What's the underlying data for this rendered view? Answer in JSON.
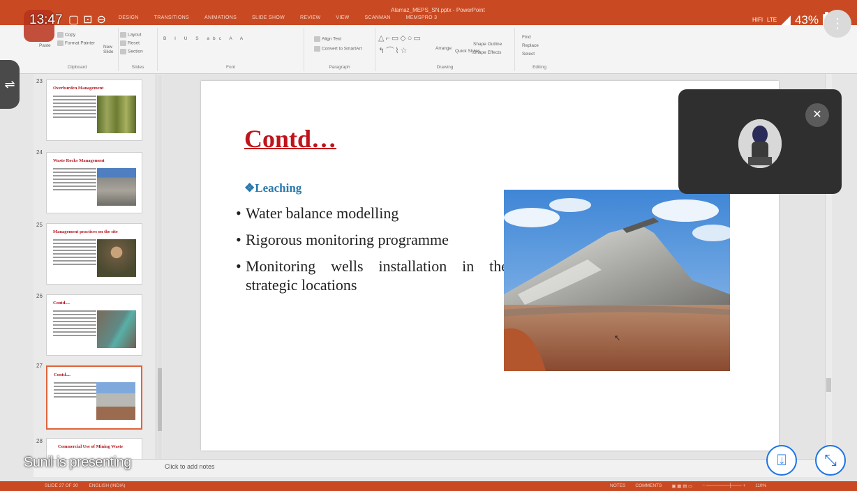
{
  "window": {
    "title": "Alamaz_MEPS_SN.pptx - PowerPoint",
    "tabs": [
      "DESIGN",
      "TRANSITIONS",
      "ANIMATIONS",
      "SLIDE SHOW",
      "REVIEW",
      "VIEW",
      "SCANMAN",
      "MEMSPRO 3"
    ]
  },
  "ribbon": {
    "clipboard": {
      "copy": "Copy",
      "format_painter": "Format Painter",
      "paste": "Paste",
      "label": "Clipboard"
    },
    "slides": {
      "new_slide": "New Slide",
      "layout": "Layout",
      "reset": "Reset",
      "section": "Section",
      "label": "Slides"
    },
    "font": {
      "label": "Font"
    },
    "paragraph": {
      "align_text": "Align Text",
      "convert_smartart": "Convert to SmartArt",
      "label": "Paragraph"
    },
    "drawing": {
      "arrange": "Arrange",
      "quick_styles": "Quick Styles",
      "shape_outline": "Shape Outline",
      "shape_effects": "Shape Effects",
      "label": "Drawing"
    },
    "editing": {
      "find": "Find",
      "replace": "Replace",
      "select": "Select",
      "label": "Editing"
    }
  },
  "phone_status": {
    "time": "13:47",
    "network": "HIFI",
    "lte": "LTE",
    "battery": "43%"
  },
  "thumbnails": [
    {
      "number": "23",
      "title": "Overburden Management",
      "pic_color": "#7a8a3a"
    },
    {
      "number": "24",
      "title": "Waste Rocks Management",
      "pic_color": "#8a8a86"
    },
    {
      "number": "25",
      "title": "Management practices on the site",
      "pic_color": "#6b5a40"
    },
    {
      "number": "26",
      "title": "Contd....",
      "pic_color": "#5f8a86"
    },
    {
      "number": "27",
      "title": "Contd....",
      "pic_color": "#9c8c7c"
    },
    {
      "number": "28",
      "title": "Commercial Use of Mining Waste",
      "pic_color": "#8c8c8c"
    }
  ],
  "slide": {
    "title": "Contd…",
    "subheading": "❖Leaching",
    "bullets": [
      "Water balance modelling",
      "Rigorous monitoring programme",
      "Monitoring wells installation in the strategic locations"
    ]
  },
  "notes": {
    "placeholder": "Click to add notes"
  },
  "statusbar": {
    "slide_counter": "SLIDE 27 OF 30",
    "language": "ENGLISH (INDIA)",
    "notes_btn": "NOTES",
    "comments_btn": "COMMENTS",
    "zoom": "110%"
  },
  "meeting": {
    "presenting_label": "Sunil is presenting"
  },
  "colors": {
    "accent": "#c94a22",
    "title_red": "#c0141c",
    "subhead_blue": "#2a79ac",
    "meet_blue": "#1a73e8"
  }
}
